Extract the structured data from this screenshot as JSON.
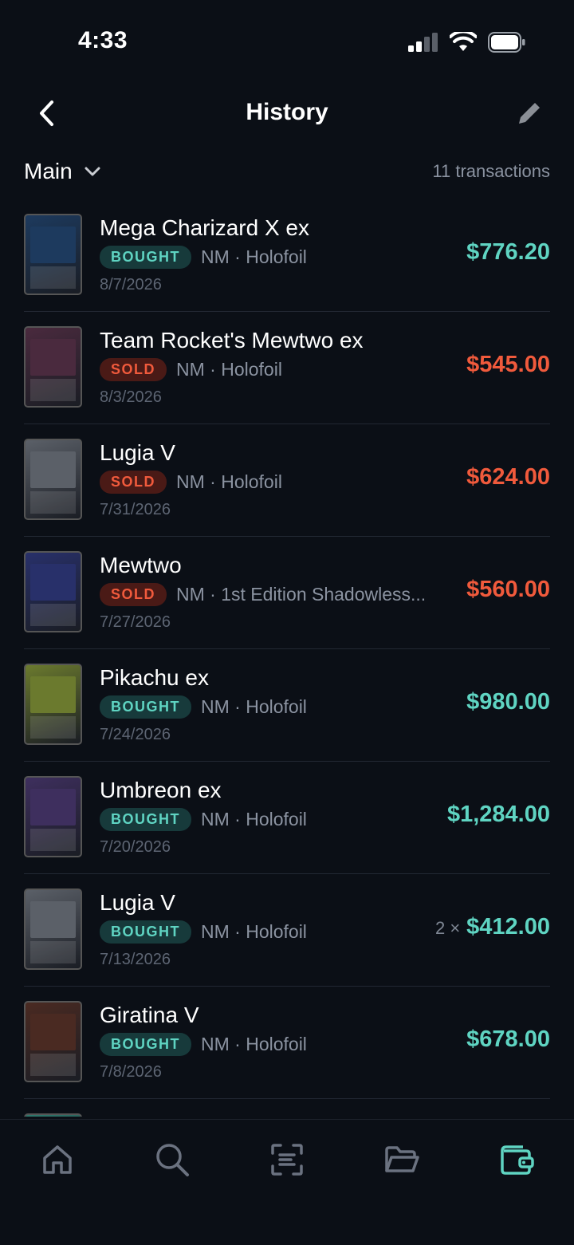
{
  "status_bar": {
    "time": "4:33"
  },
  "nav": {
    "title": "History"
  },
  "filter": {
    "collection": "Main",
    "count_label": "11 transactions"
  },
  "colors": {
    "bought": "#5fd4c2",
    "sold": "#f05a3c",
    "background": "#0b0f16"
  },
  "transactions": [
    {
      "name": "Mega Charizard X ex",
      "type": "BOUGHT",
      "condition": "NM · Holofoil",
      "date": "8/7/2026",
      "qty": "",
      "price": "$776.20",
      "art": "#1d3a5e"
    },
    {
      "name": "Team Rocket's Mewtwo ex",
      "type": "SOLD",
      "condition": "NM · Holofoil",
      "date": "8/3/2026",
      "qty": "",
      "price": "$545.00",
      "art": "#4a2a3e"
    },
    {
      "name": "Lugia V",
      "type": "SOLD",
      "condition": "NM · Holofoil",
      "date": "7/31/2026",
      "qty": "",
      "price": "$624.00",
      "art": "#5b6068"
    },
    {
      "name": "Mewtwo",
      "type": "SOLD",
      "condition": "NM · 1st Edition Shadowless...",
      "date": "7/27/2026",
      "qty": "",
      "price": "$560.00",
      "art": "#28306a"
    },
    {
      "name": "Pikachu ex",
      "type": "BOUGHT",
      "condition": "NM · Holofoil",
      "date": "7/24/2026",
      "qty": "",
      "price": "$980.00",
      "art": "#6b7a2e"
    },
    {
      "name": "Umbreon ex",
      "type": "BOUGHT",
      "condition": "NM · Holofoil",
      "date": "7/20/2026",
      "qty": "",
      "price": "$1,284.00",
      "art": "#3e2f5e"
    },
    {
      "name": "Lugia V",
      "type": "BOUGHT",
      "condition": "NM · Holofoil",
      "date": "7/13/2026",
      "qty": "2 ×",
      "price": "$412.00",
      "art": "#5b6068"
    },
    {
      "name": "Giratina V",
      "type": "BOUGHT",
      "condition": "NM · Holofoil",
      "date": "7/8/2026",
      "qty": "",
      "price": "$678.00",
      "art": "#4a2a22"
    },
    {
      "name": "",
      "type": "",
      "condition": "",
      "date": "",
      "qty": "",
      "price": "",
      "art": "#2e7a6e"
    }
  ],
  "tab_bar": {
    "items": [
      {
        "icon": "home-icon",
        "active": false
      },
      {
        "icon": "search-icon",
        "active": false
      },
      {
        "icon": "scan-icon",
        "active": false
      },
      {
        "icon": "folder-icon",
        "active": false
      },
      {
        "icon": "wallet-icon",
        "active": true
      }
    ]
  }
}
